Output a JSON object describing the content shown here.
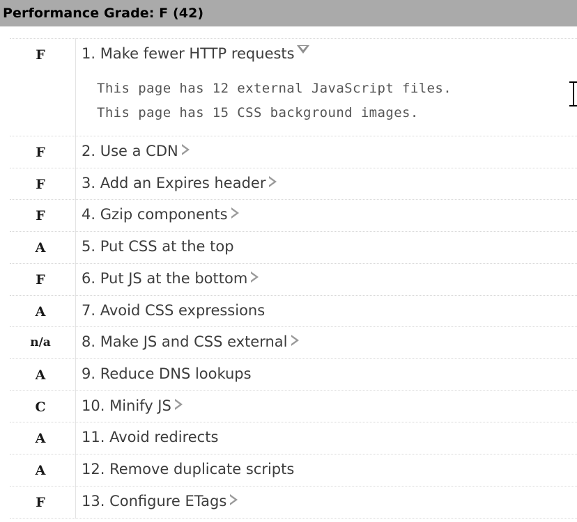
{
  "header": {
    "title": "Performance Grade: F (42)",
    "background_color": "#aaaaaa",
    "text_color": "#000000"
  },
  "rules": [
    {
      "grade": "F",
      "label": "1. Make fewer HTTP requests",
      "expander": "expanded",
      "details": [
        "This page has 12 external JavaScript files.",
        "This page has 15 CSS background images."
      ]
    },
    {
      "grade": "F",
      "label": "2. Use a CDN",
      "expander": "collapsed",
      "details": []
    },
    {
      "grade": "F",
      "label": "3. Add an Expires header",
      "expander": "collapsed",
      "details": []
    },
    {
      "grade": "F",
      "label": "4. Gzip components",
      "expander": "collapsed",
      "details": []
    },
    {
      "grade": "A",
      "label": "5. Put CSS at the top",
      "expander": "none",
      "details": []
    },
    {
      "grade": "F",
      "label": "6. Put JS at the bottom",
      "expander": "collapsed",
      "details": []
    },
    {
      "grade": "A",
      "label": "7. Avoid CSS expressions",
      "expander": "none",
      "details": []
    },
    {
      "grade": "n/a",
      "label": "8. Make JS and CSS external",
      "expander": "collapsed",
      "details": []
    },
    {
      "grade": "A",
      "label": "9. Reduce DNS lookups",
      "expander": "none",
      "details": []
    },
    {
      "grade": "C",
      "label": "10. Minify JS",
      "expander": "collapsed",
      "details": []
    },
    {
      "grade": "A",
      "label": "11. Avoid redirects",
      "expander": "none",
      "details": []
    },
    {
      "grade": "A",
      "label": "12. Remove duplicate scripts",
      "expander": "none",
      "details": []
    },
    {
      "grade": "F",
      "label": "13. Configure ETags",
      "expander": "collapsed",
      "details": []
    }
  ],
  "cursor": {
    "type": "text-ibeam-cursor"
  }
}
